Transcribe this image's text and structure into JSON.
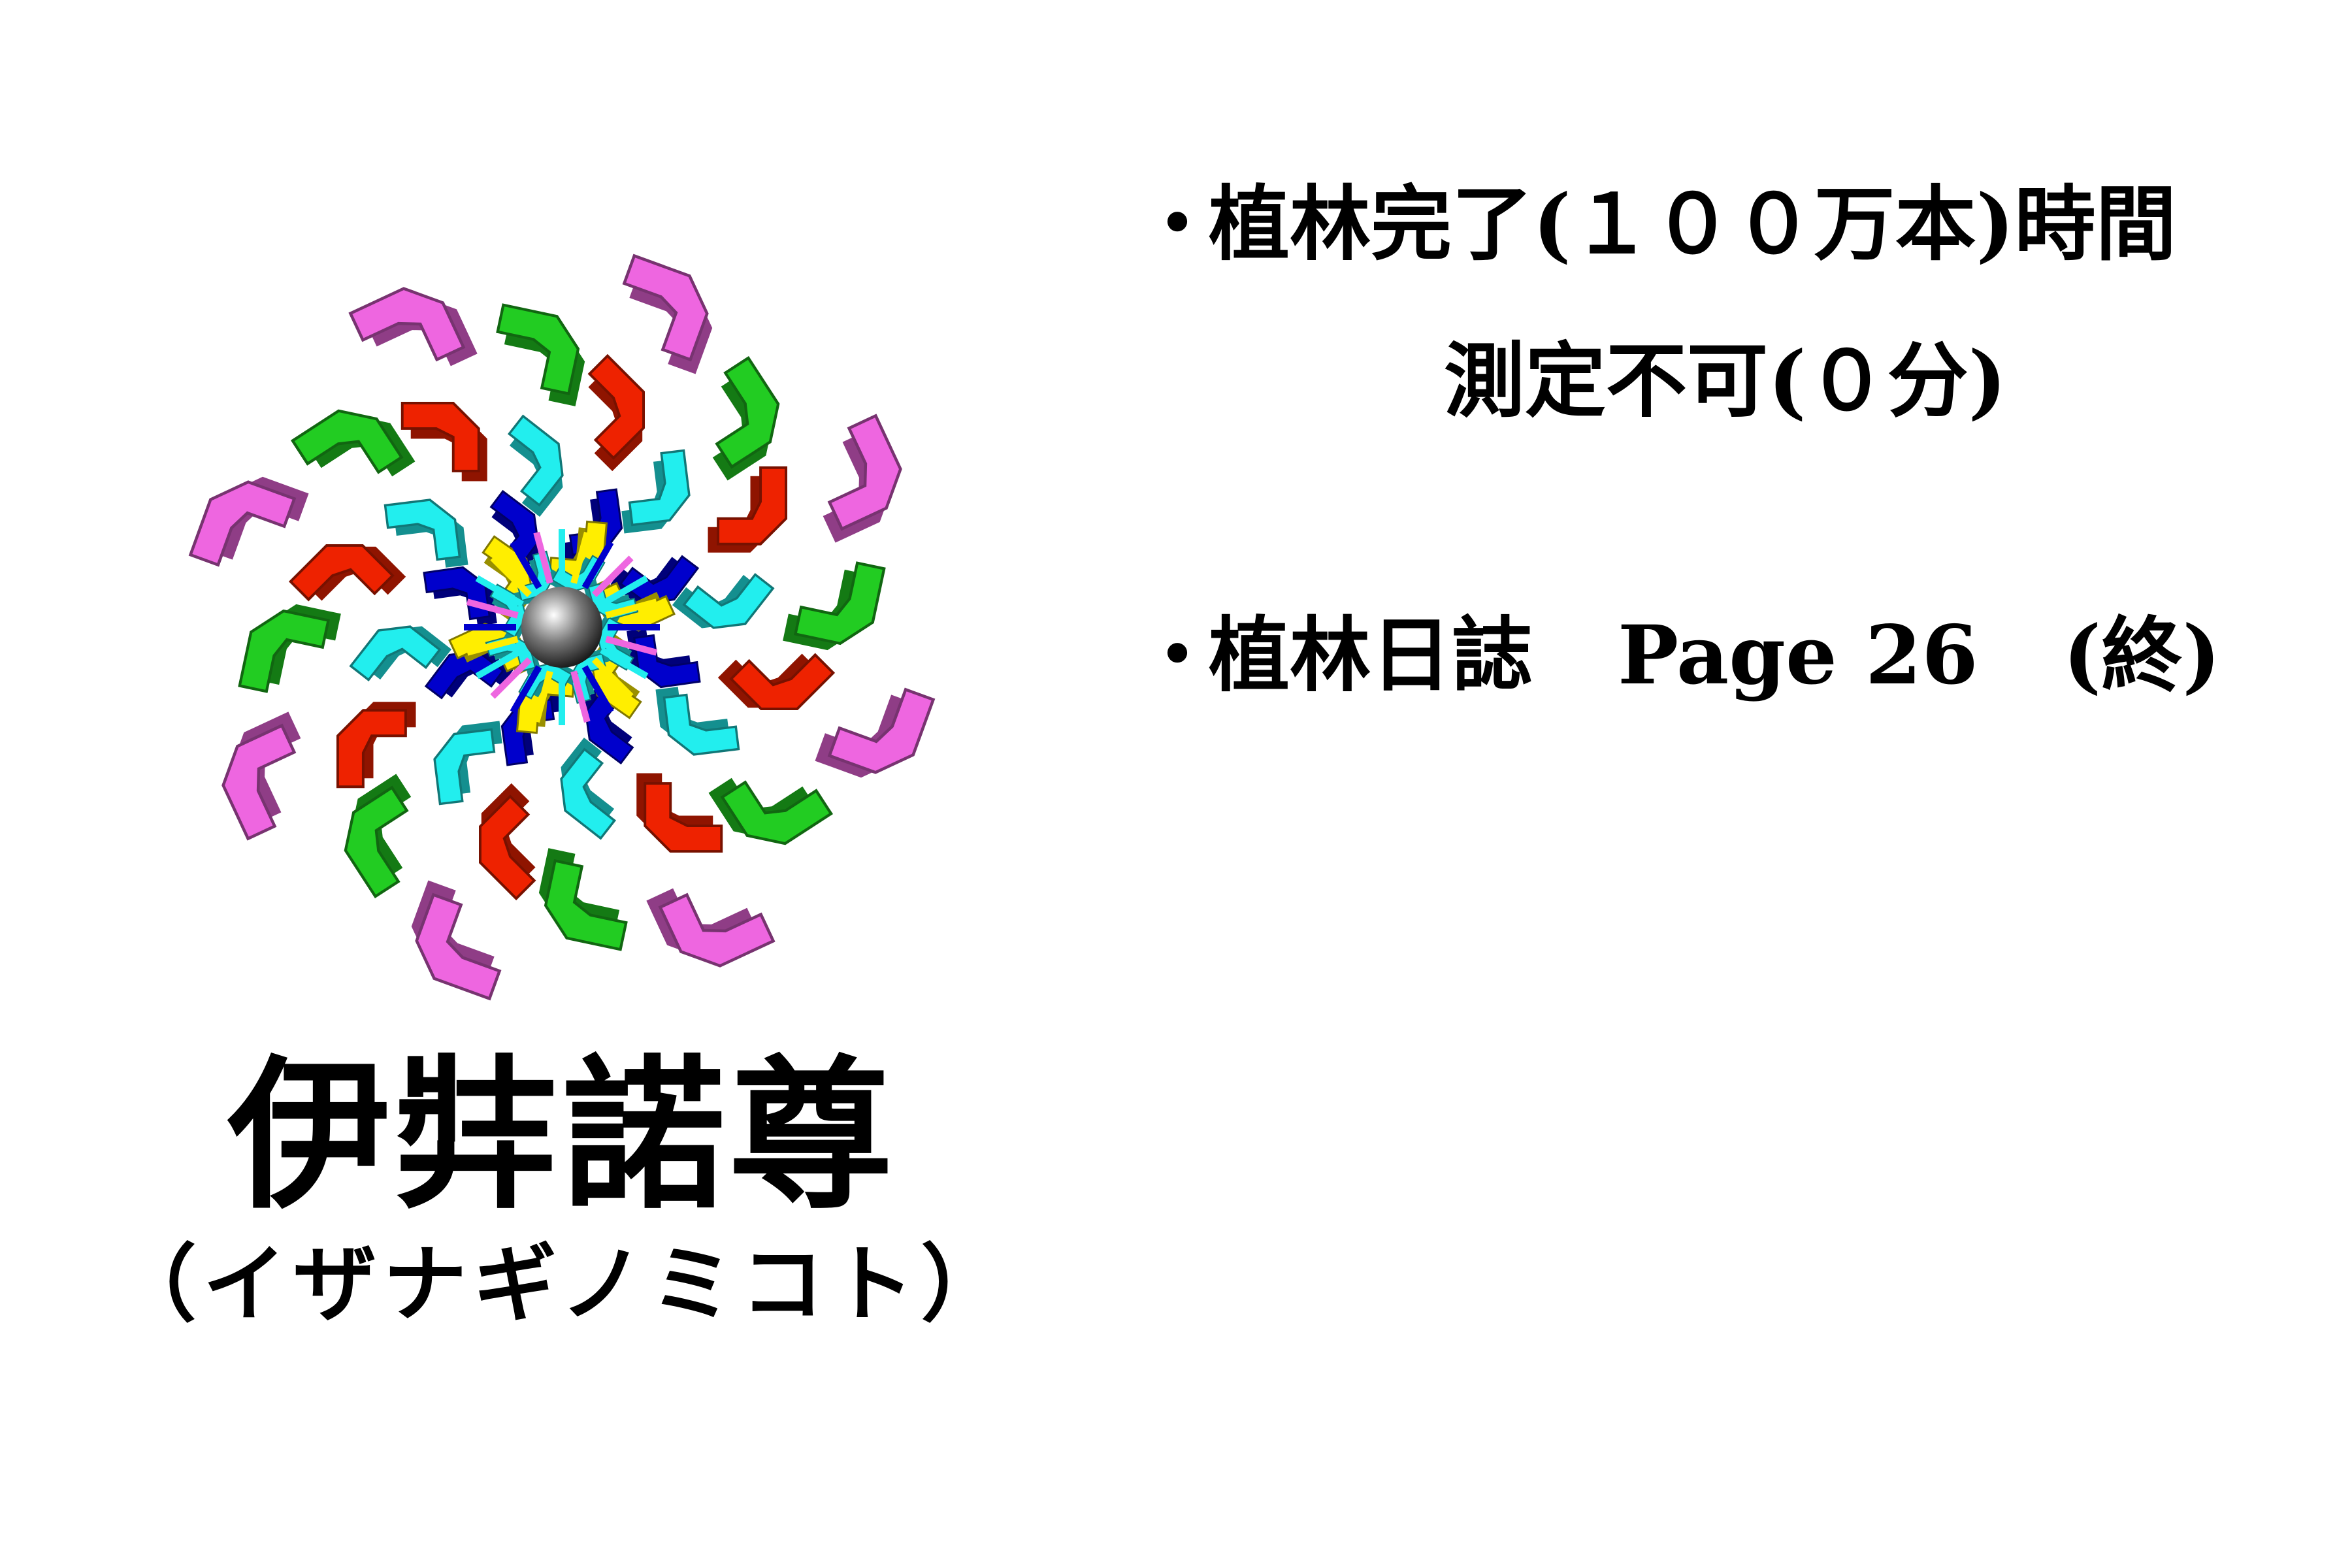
{
  "emblem": {
    "icon": "mandala-flower-icon",
    "colors": {
      "pink": "#ee66e0",
      "green": "#22cc22",
      "red": "#ee2200",
      "cyan": "#22eeee",
      "yellow": "#ffee00",
      "blue": "#0000cc",
      "center": "#444444"
    }
  },
  "title": {
    "main": "伊弉諾尊",
    "sub": "（イザナギノミコト）"
  },
  "info": {
    "bullet": "・",
    "line1": "植林完了(１００万本)時間",
    "line2": "測定不可(０分)",
    "line3_label": "植林日誌",
    "line3_page": "Page 26",
    "line3_end": "(終)"
  }
}
